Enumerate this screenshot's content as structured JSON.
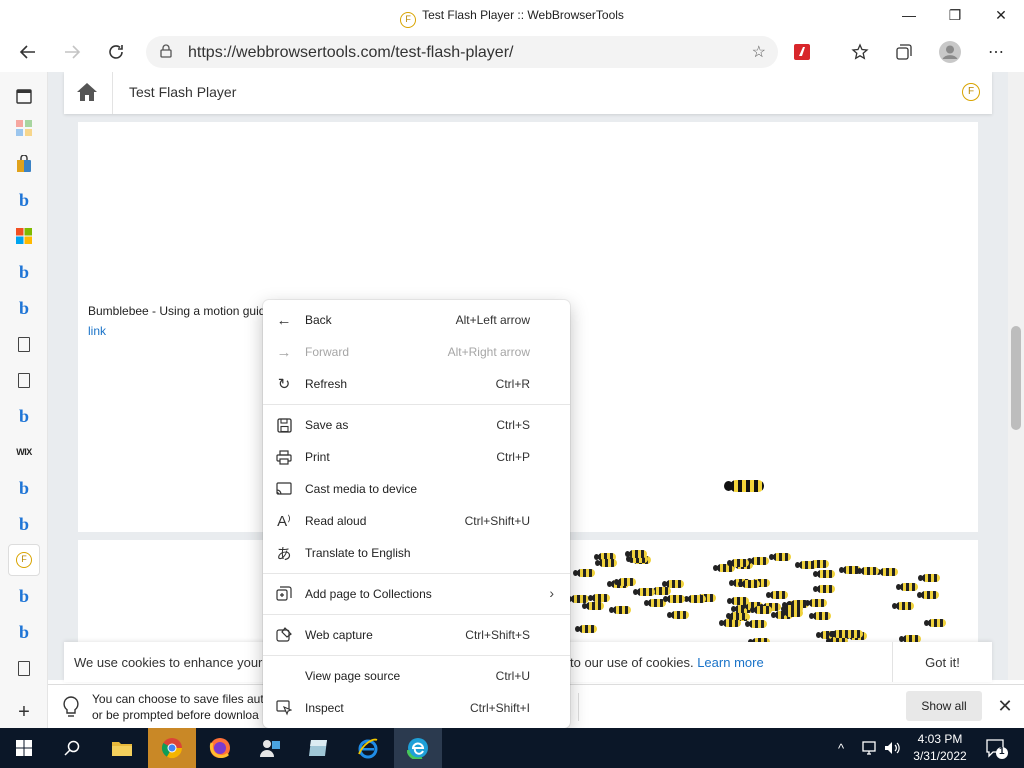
{
  "window": {
    "title": "Test Flash Player :: WebBrowserTools",
    "favicon_letter": "F",
    "minimize_glyph": "—",
    "restore_glyph": "❐",
    "close_glyph": "✕"
  },
  "navbar": {
    "url": "https://webbrowsertools.com/test-flash-player/"
  },
  "sidebar": {
    "items": [
      {
        "icon": "collections-icon"
      },
      {
        "icon": "tiles-icon"
      },
      {
        "icon": "shopping-icon"
      },
      {
        "icon": "bing-icon",
        "glyph": "b"
      },
      {
        "icon": "microsoft-icon"
      },
      {
        "icon": "bing-icon",
        "glyph": "b"
      },
      {
        "icon": "bing-icon",
        "glyph": "b"
      },
      {
        "icon": "document-icon"
      },
      {
        "icon": "document-icon"
      },
      {
        "icon": "bing-icon",
        "glyph": "b"
      },
      {
        "icon": "wix-icon",
        "glyph": "WIX"
      },
      {
        "icon": "bing-icon",
        "glyph": "b"
      },
      {
        "icon": "bing-icon",
        "glyph": "b"
      },
      {
        "icon": "flash-tools-icon",
        "glyph": "F"
      },
      {
        "icon": "bing-icon",
        "glyph": "b"
      },
      {
        "icon": "bing-icon",
        "glyph": "b"
      },
      {
        "icon": "document-icon"
      }
    ],
    "add_glyph": "+"
  },
  "page": {
    "title": "Test Flash Player",
    "badge_letter": "F",
    "caption": "Bumblebee - Using a motion guid",
    "link_text": "link"
  },
  "cookie": {
    "text_left": "We use cookies to enhance your",
    "text_right": "to our use of cookies.",
    "learn_more": "Learn more",
    "got_it": "Got it!"
  },
  "download_bar": {
    "line1": "You can choose to save files auto",
    "line2": "or be prompted before downloa",
    "show_all": "Show all"
  },
  "context_menu": {
    "back": {
      "label": "Back",
      "shortcut": "Alt+Left arrow",
      "glyph": "←"
    },
    "forward": {
      "label": "Forward",
      "shortcut": "Alt+Right arrow",
      "glyph": "→"
    },
    "refresh": {
      "label": "Refresh",
      "shortcut": "Ctrl+R",
      "glyph": "↻"
    },
    "save_as": {
      "label": "Save as",
      "shortcut": "Ctrl+S"
    },
    "print": {
      "label": "Print",
      "shortcut": "Ctrl+P"
    },
    "cast": {
      "label": "Cast media to device"
    },
    "read_aloud": {
      "label": "Read aloud",
      "shortcut": "Ctrl+Shift+U",
      "glyph": "A⁾"
    },
    "translate": {
      "label": "Translate to English",
      "glyph": "あ"
    },
    "collections": {
      "label": "Add page to Collections",
      "chevron": "›"
    },
    "web_capture": {
      "label": "Web capture",
      "shortcut": "Ctrl+Shift+S"
    },
    "view_source": {
      "label": "View page source",
      "shortcut": "Ctrl+U"
    },
    "inspect": {
      "label": "Inspect",
      "shortcut": "Ctrl+Shift+I"
    }
  },
  "taskbar": {
    "time": "4:03 PM",
    "date": "3/31/2022",
    "notification_count": "1",
    "tray_chevron": "^"
  },
  "colors": {
    "taskbar_bg": "#0b1728",
    "link_blue": "#1a73c8",
    "bee_yellow": "#f0d23c"
  }
}
